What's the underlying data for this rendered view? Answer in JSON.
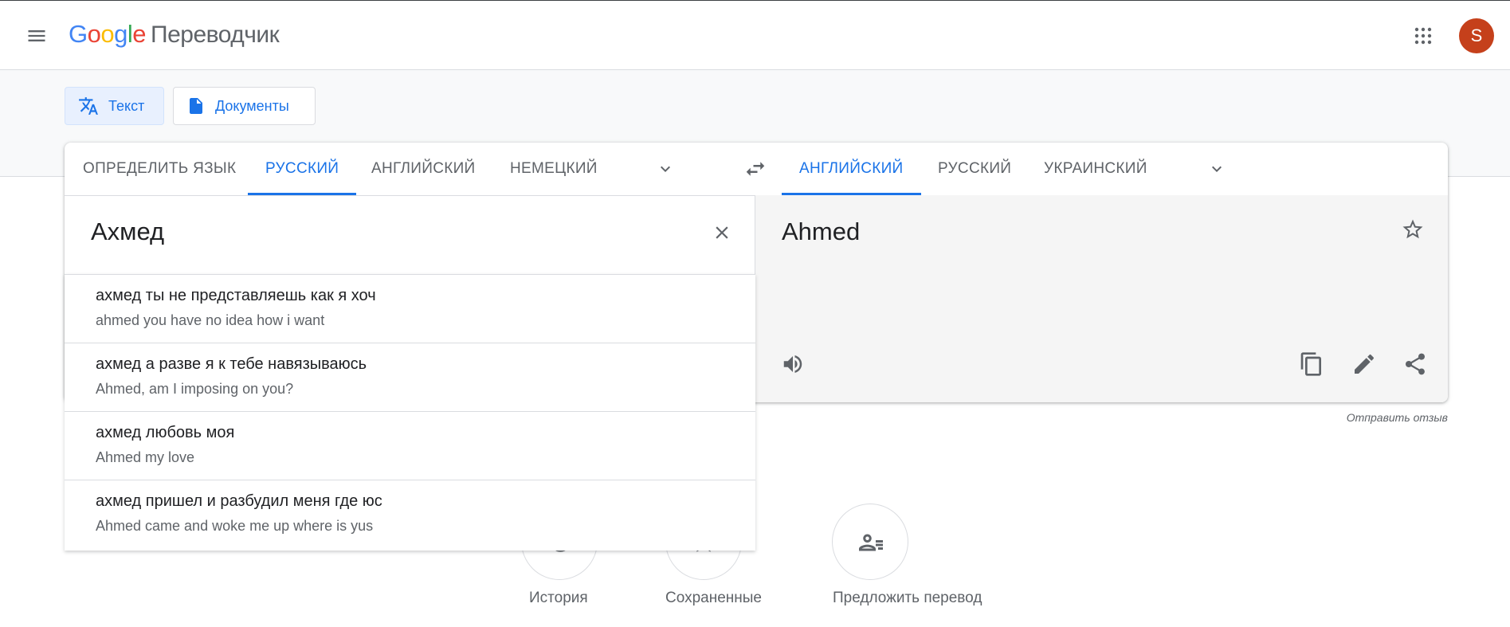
{
  "header": {
    "logo_letters": [
      "G",
      "o",
      "o",
      "g",
      "l",
      "e"
    ],
    "product_name": "Переводчик",
    "avatar_letter": "S",
    "icons": {
      "menu": "menu-icon",
      "apps": "apps-grid-icon"
    },
    "colors": {
      "avatar": "#c5401b",
      "accent": "#1a73e8"
    }
  },
  "modes": [
    {
      "label": "Текст",
      "icon": "translate-icon",
      "active": true
    },
    {
      "label": "Документы",
      "icon": "document-icon",
      "active": false
    }
  ],
  "source_langs": {
    "items": [
      "Определить язык",
      "Русский",
      "Английский",
      "Немецкий"
    ],
    "active": "Русский"
  },
  "target_langs": {
    "items": [
      "Английский",
      "Русский",
      "Украинский"
    ],
    "active": "Английский"
  },
  "source": {
    "text": "Ахмед"
  },
  "target": {
    "text": "Ahmed"
  },
  "feedback": "Отправить отзыв",
  "suggestions": [
    {
      "text": "ахмед ты не представляешь как я хоч",
      "translation": "ahmed you have no idea how i want"
    },
    {
      "text": "ахмед а разве я к тебе навязываюсь",
      "translation": "Ahmed, am I imposing on you?"
    },
    {
      "text": "ахмед любовь моя",
      "translation": "Ahmed my love"
    },
    {
      "text": "ахмед пришел и разбудил меня где юс",
      "translation": "Ahmed came and woke me up where is yus"
    }
  ],
  "bottom_actions": [
    {
      "label": "История",
      "icon": "history-icon"
    },
    {
      "label": "Сохраненные",
      "icon": "saved-star-icon"
    },
    {
      "label": "Предложить перевод",
      "icon": "contribute-icon"
    }
  ]
}
